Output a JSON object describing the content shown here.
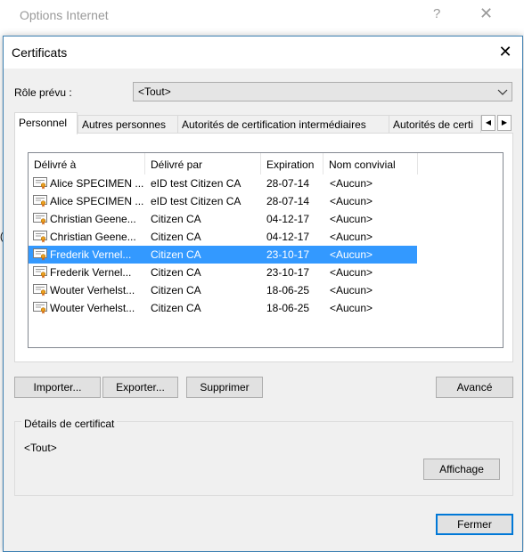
{
  "background_window": {
    "title": "Options Internet",
    "help": "?",
    "close": "✕",
    "edge_text": "("
  },
  "dialog": {
    "title": "Certificats",
    "close": "✕",
    "role_label": "Rôle prévu :",
    "role_value": "<Tout>",
    "tabs": [
      "Personnel",
      "Autres personnes",
      "Autorités de certification intermédiaires",
      "Autorités de certi"
    ],
    "active_tab": "Personnel",
    "scroll_left": "◀",
    "scroll_right": "▶",
    "columns": [
      "Délivré à",
      "Délivré par",
      "Expiration",
      "Nom convivial"
    ],
    "rows": [
      {
        "issued_to": "Alice SPECIMEN ...",
        "issued_by": "eID test Citizen CA",
        "expiration": "28-07-14",
        "friendly": "<Aucun>"
      },
      {
        "issued_to": "Alice SPECIMEN ...",
        "issued_by": "eID test Citizen CA",
        "expiration": "28-07-14",
        "friendly": "<Aucun>"
      },
      {
        "issued_to": "Christian Geene...",
        "issued_by": "Citizen CA",
        "expiration": "04-12-17",
        "friendly": "<Aucun>"
      },
      {
        "issued_to": "Christian Geene...",
        "issued_by": "Citizen CA",
        "expiration": "04-12-17",
        "friendly": "<Aucun>"
      },
      {
        "issued_to": "Frederik Vernel...",
        "issued_by": "Citizen CA",
        "expiration": "23-10-17",
        "friendly": "<Aucun>"
      },
      {
        "issued_to": "Frederik Vernel...",
        "issued_by": "Citizen CA",
        "expiration": "23-10-17",
        "friendly": "<Aucun>"
      },
      {
        "issued_to": "Wouter Verhelst...",
        "issued_by": "Citizen CA",
        "expiration": "18-06-25",
        "friendly": "<Aucun>"
      },
      {
        "issued_to": "Wouter Verhelst...",
        "issued_by": "Citizen CA",
        "expiration": "18-06-25",
        "friendly": "<Aucun>"
      }
    ],
    "selected_row_index": 4,
    "buttons": {
      "import": "Importer...",
      "export": "Exporter...",
      "remove": "Supprimer",
      "advanced": "Avancé",
      "view": "Affichage",
      "close": "Fermer"
    },
    "details_label": "Détails de certificat",
    "details_value": "<Tout>"
  },
  "colors": {
    "selection": "#3399ff",
    "accent_border": "#0078d7"
  }
}
